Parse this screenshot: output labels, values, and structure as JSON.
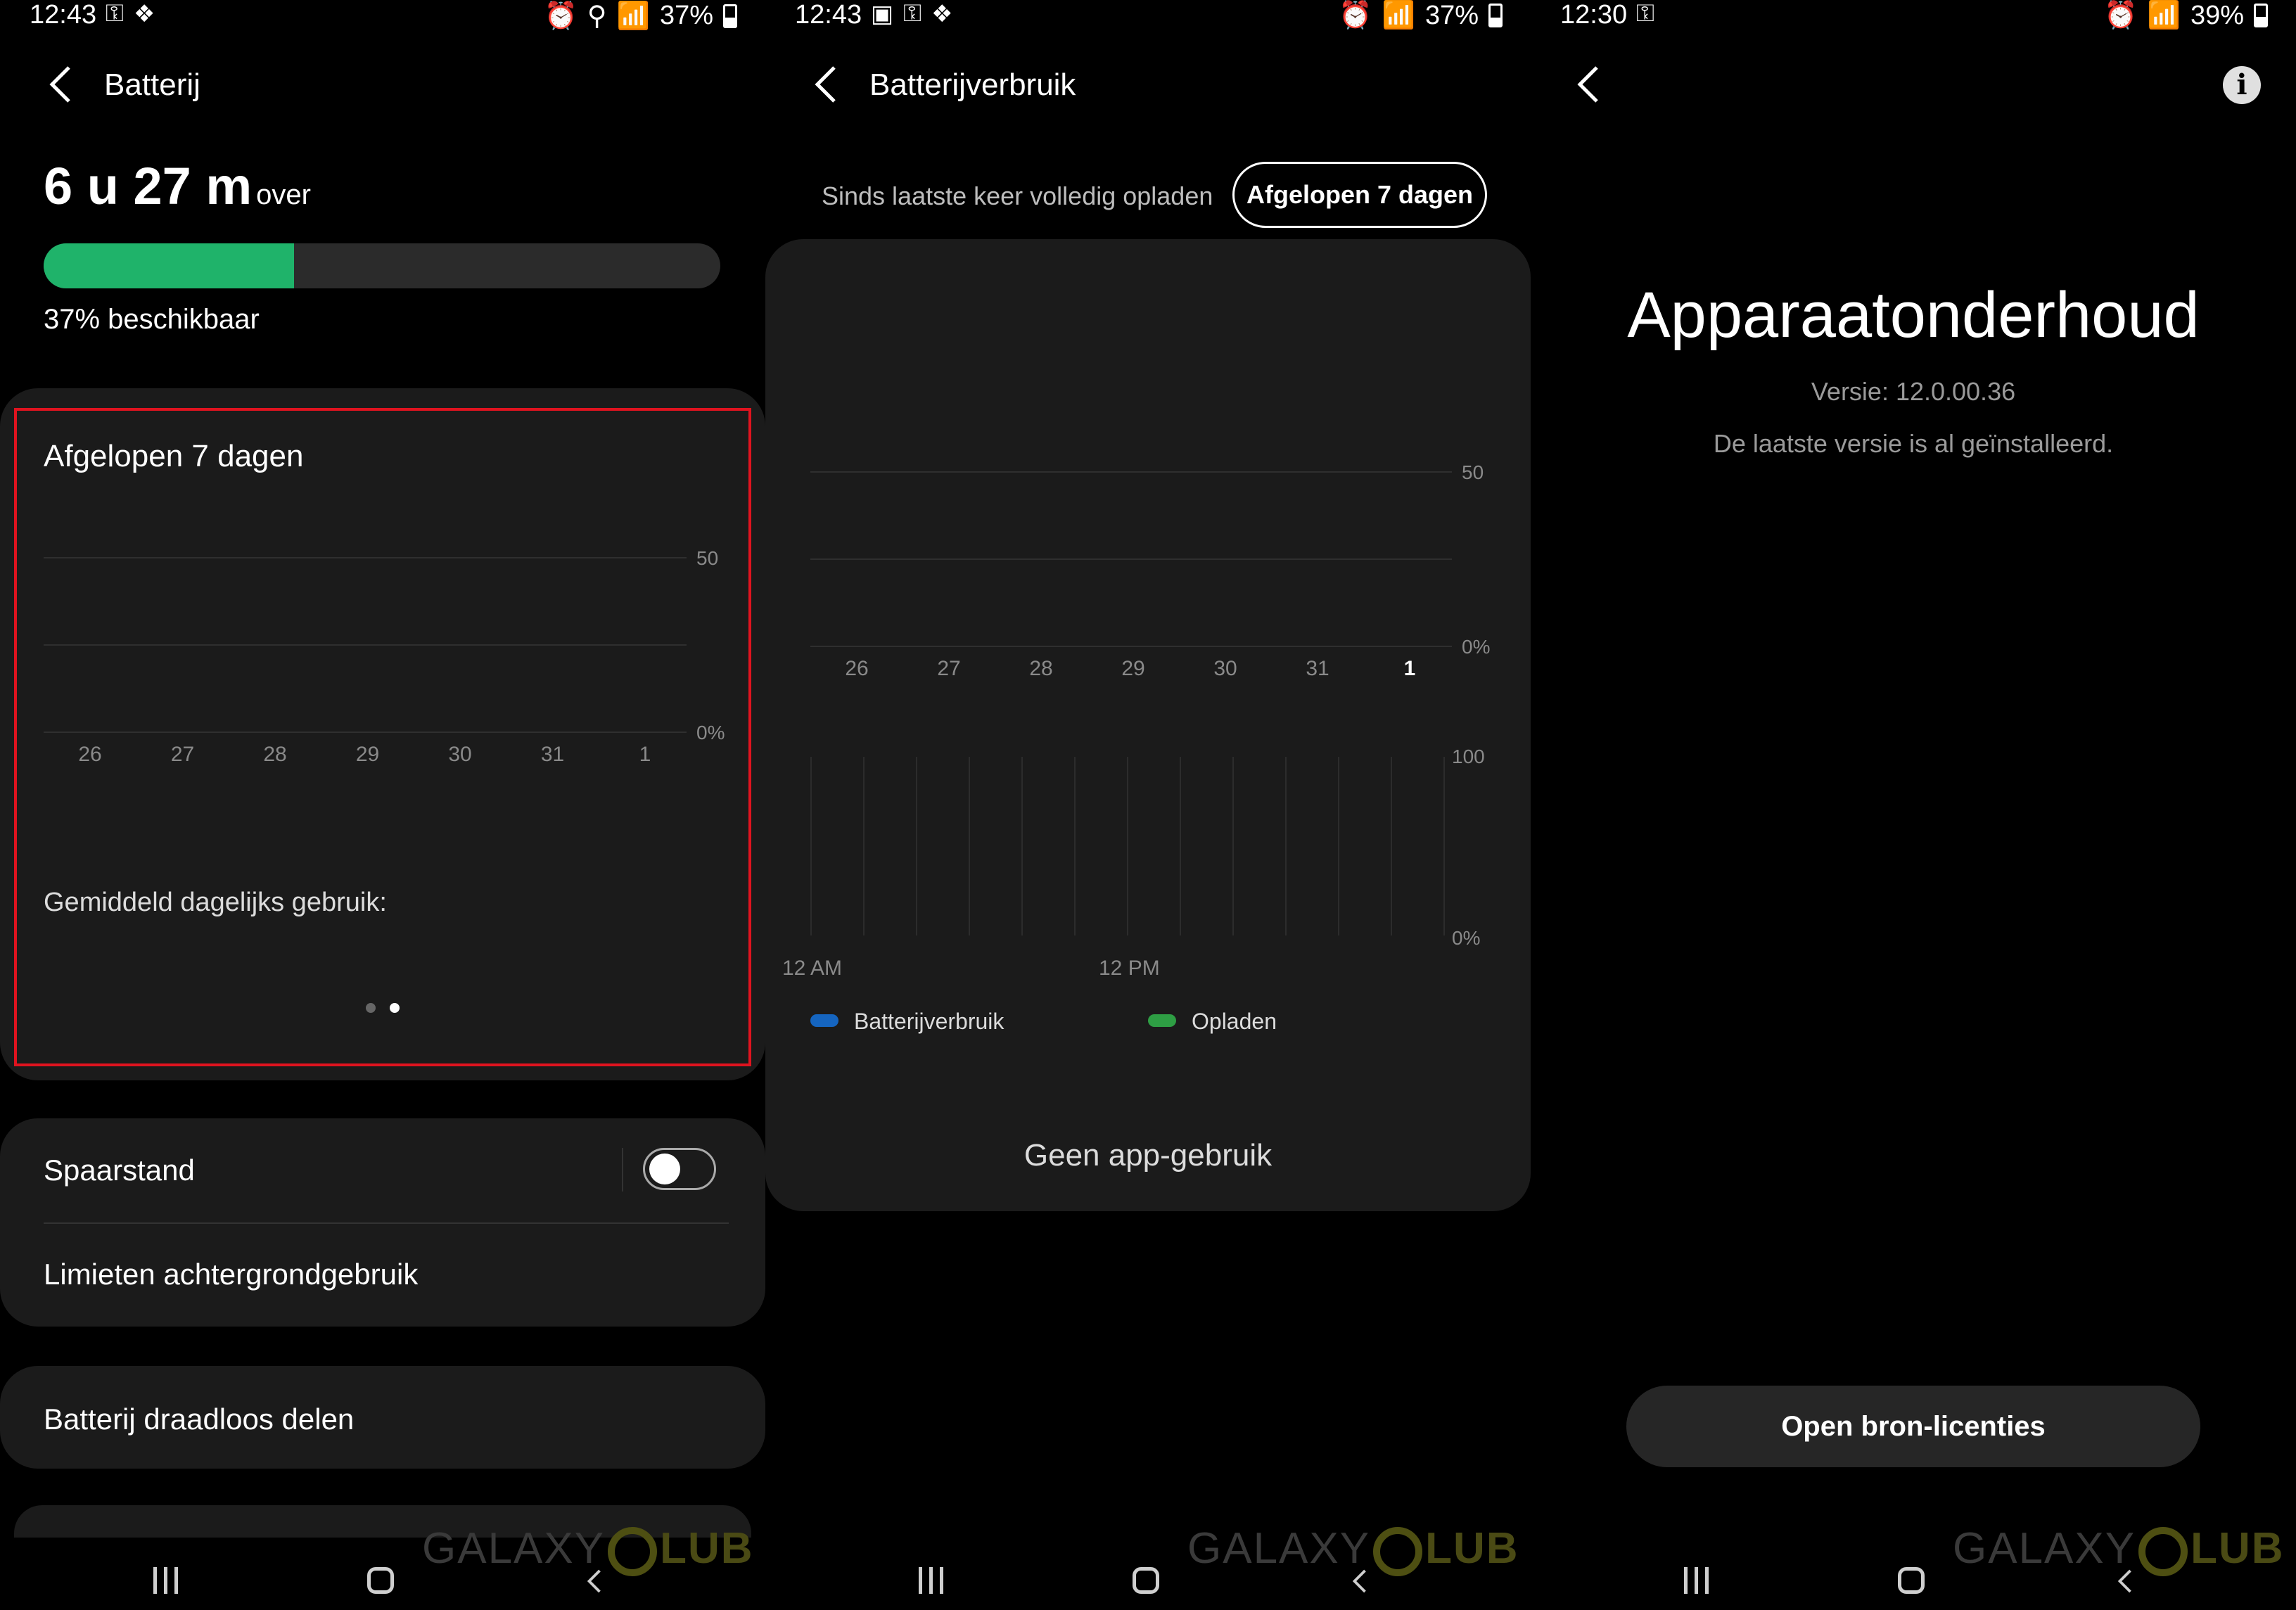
{
  "panel1": {
    "status": {
      "time": "12:43",
      "battery": "37%"
    },
    "header": {
      "title": "Batterij"
    },
    "remaining": {
      "value": "6 u 27 m",
      "suffix": "over"
    },
    "battery_level": 0.37,
    "available": "37% beschikbaar",
    "card": {
      "title": "Afgelopen 7 dagen",
      "avg_label": "Gemiddeld dagelijks gebruik:",
      "page_indicator": {
        "count": 2,
        "active": 1
      }
    },
    "spaarstand": {
      "label": "Spaarstand",
      "on": false
    },
    "limits": "Limieten achtergrondgebruik",
    "wireless": "Batterij draadloos delen"
  },
  "panel2": {
    "status": {
      "time": "12:43",
      "battery": "37%"
    },
    "header": {
      "title": "Batterijverbruik"
    },
    "tabs": {
      "since_charge": "Sinds laatste keer volledig opladen",
      "last7": "Afgelopen 7 dagen"
    },
    "legend": {
      "usage": "Batterijverbruik",
      "charging": "Opladen"
    },
    "hour_labels": {
      "start": "12 AM",
      "mid": "12 PM"
    },
    "no_app": "Geen app-gebruik",
    "colors": {
      "usage": "#1565c0",
      "charging": "#2e9e44"
    }
  },
  "panel3": {
    "status": {
      "time": "12:30",
      "battery": "39%"
    },
    "title": "Apparaatonderhoud",
    "version": "Versie: 12.0.00.36",
    "latest": "De laatste versie is al geïnstalleerd.",
    "open_source": "Open bron-licenties"
  },
  "watermark": {
    "text": "GALAXY",
    "suffix": "LUB"
  },
  "chart_data": [
    {
      "type": "bar",
      "title": "Afgelopen 7 dagen",
      "categories": [
        "26",
        "27",
        "28",
        "29",
        "30",
        "31",
        "1"
      ],
      "values": [
        0,
        0,
        0,
        0,
        0,
        0,
        0
      ],
      "yticks": [
        "50",
        "0%"
      ],
      "ylim": [
        0,
        100
      ]
    },
    {
      "type": "bar",
      "categories": [
        "26",
        "27",
        "28",
        "29",
        "30",
        "31",
        "1"
      ],
      "values": [
        0,
        0,
        0,
        0,
        0,
        0,
        0
      ],
      "yticks": [
        "50",
        "0%"
      ],
      "ylim": [
        0,
        100
      ],
      "highlight": "1"
    },
    {
      "type": "bar",
      "x": [
        "12 AM",
        "12 PM"
      ],
      "series": [
        {
          "name": "Batterijverbruik",
          "values": []
        },
        {
          "name": "Opladen",
          "values": []
        }
      ],
      "yticks": [
        "100",
        "0%"
      ],
      "ylim": [
        0,
        100
      ]
    }
  ]
}
